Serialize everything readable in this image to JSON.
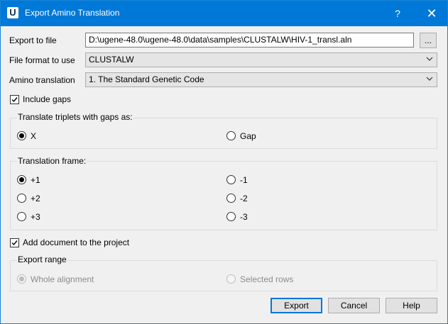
{
  "window": {
    "title": "Export Amino Translation",
    "app_icon": "U",
    "help_glyph": "?",
    "close_glyph": "✕"
  },
  "export_file": {
    "label": "Export to file",
    "value": "D:\\ugene-48.0\\ugene-48.0\\data\\samples\\CLUSTALW\\HIV-1_transl.aln",
    "browse_label": "..."
  },
  "file_format": {
    "label": "File format to use",
    "value": "CLUSTALW"
  },
  "amino_translation": {
    "label": "Amino translation",
    "value": "1. The Standard Genetic Code"
  },
  "include_gaps": {
    "label": "Include gaps",
    "checked": true
  },
  "gap_group": {
    "title": "Translate triplets with gaps as:",
    "options": [
      {
        "label": "X",
        "selected": true
      },
      {
        "label": "Gap",
        "selected": false
      }
    ]
  },
  "frame_group": {
    "title": "Translation frame:",
    "options": [
      {
        "label": "+1",
        "selected": true
      },
      {
        "label": "-1",
        "selected": false
      },
      {
        "label": "+2",
        "selected": false
      },
      {
        "label": "-2",
        "selected": false
      },
      {
        "label": "+3",
        "selected": false
      },
      {
        "label": "-3",
        "selected": false
      }
    ]
  },
  "add_document": {
    "label": "Add document to the project",
    "checked": true
  },
  "export_range": {
    "title": "Export range",
    "enabled": false,
    "options": [
      {
        "label": "Whole alignment",
        "selected": true
      },
      {
        "label": "Selected rows",
        "selected": false
      }
    ]
  },
  "buttons": {
    "export": "Export",
    "cancel": "Cancel",
    "help": "Help"
  },
  "colors": {
    "titlebar": "#0078d7",
    "focus": "#0078d7"
  }
}
